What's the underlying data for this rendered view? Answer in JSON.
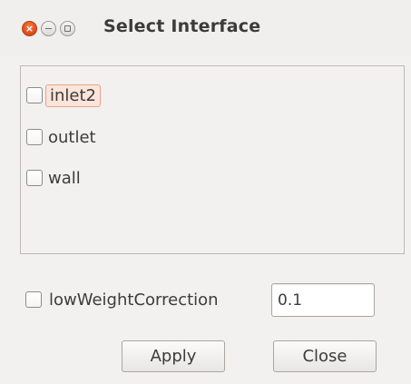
{
  "window": {
    "title": "Select Interface",
    "controls": {
      "close_glyph": "×",
      "close_icon": "close-icon",
      "minimize_icon": "minimize-icon",
      "maximize_icon": "maximize-icon"
    },
    "accent_colors": {
      "close_button": "#df4b16",
      "focus_highlight": "#fbe4da"
    }
  },
  "interfaces": {
    "items": [
      {
        "label": "inlet2",
        "checked": false,
        "focused": true
      },
      {
        "label": "outlet",
        "checked": false,
        "focused": false
      },
      {
        "label": "wall",
        "checked": false,
        "focused": false
      }
    ]
  },
  "options": {
    "low_weight_correction": {
      "label": "lowWeightCorrection",
      "checked": false,
      "value": "0.1"
    }
  },
  "buttons": {
    "apply_label": "Apply",
    "close_label": "Close"
  }
}
